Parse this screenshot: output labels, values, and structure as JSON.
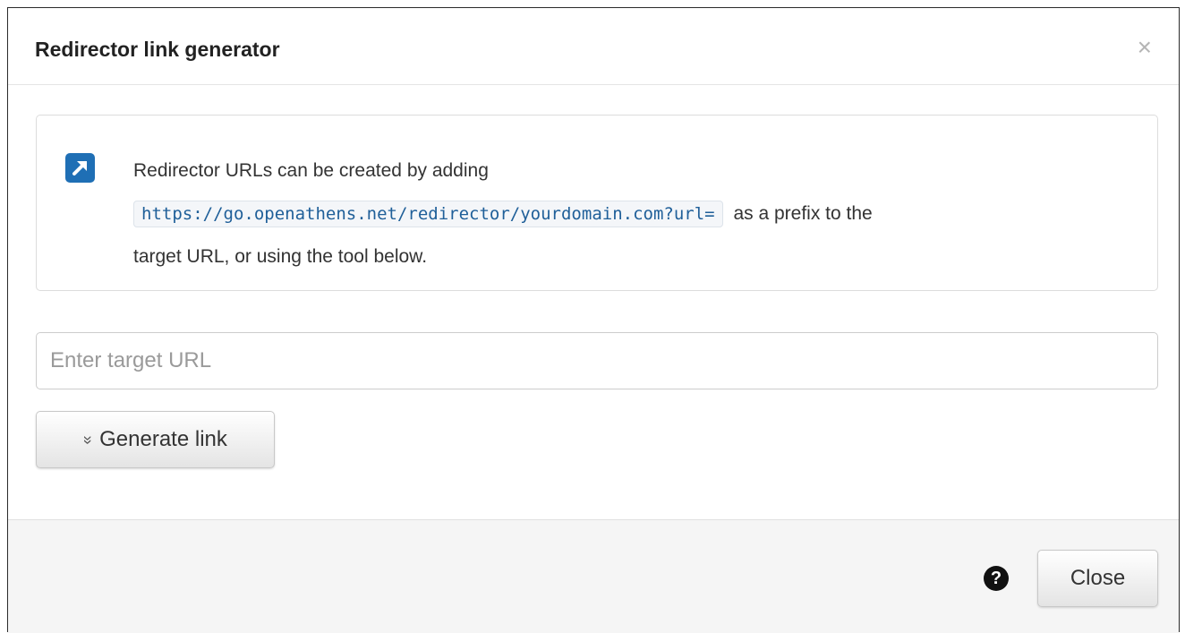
{
  "dialog": {
    "title": "Redirector link generator",
    "close_glyph": "×"
  },
  "info": {
    "icon": "external-link-icon",
    "text_before": "Redirector URLs can be created by adding",
    "prefix_code": "https://go.openathens.net/redirector/yourdomain.com?url=",
    "text_after_code": "as a prefix to the",
    "text_end": "target URL, or using the tool below."
  },
  "form": {
    "target_url_value": "",
    "target_url_placeholder": "Enter target URL",
    "generate_icon": "double-chevron-down-icon",
    "generate_chevron_glyph": "»",
    "generate_label": "Generate link"
  },
  "footer": {
    "help_icon": "question-circle-icon",
    "help_glyph": "?",
    "close_label": "Close"
  },
  "colors": {
    "icon_blue": "#1f6fb5",
    "code_text": "#1f5f99",
    "footer_bg": "#f5f5f5"
  }
}
